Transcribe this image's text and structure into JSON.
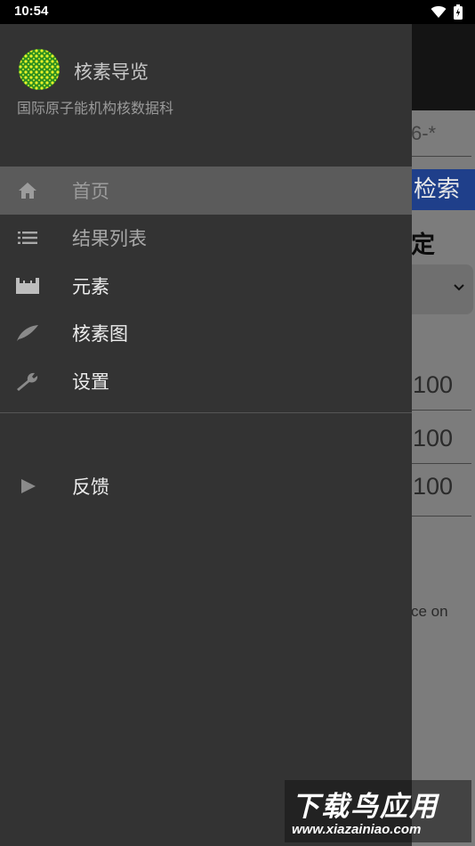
{
  "status_bar": {
    "time": "10:54"
  },
  "background_app": {
    "field_value": "6-*",
    "search_button": "检索",
    "section_label": "定",
    "numbers": [
      "100",
      "100",
      "100"
    ],
    "trailing_text": "ce on"
  },
  "drawer": {
    "title": "核素导览",
    "subtitle": "国际原子能机构核数据科",
    "items": [
      {
        "label": "首页",
        "icon": "home-icon"
      },
      {
        "label": "结果列表",
        "icon": "list-icon"
      },
      {
        "label": "元素",
        "icon": "table-icon"
      },
      {
        "label": "核素图",
        "icon": "leaf-icon"
      },
      {
        "label": "设置",
        "icon": "wrench-icon"
      }
    ],
    "feedback": {
      "label": "反馈",
      "icon": "send-icon"
    }
  },
  "watermark": {
    "main": "下载鸟应用",
    "url": "www.xiazainiao.com"
  }
}
